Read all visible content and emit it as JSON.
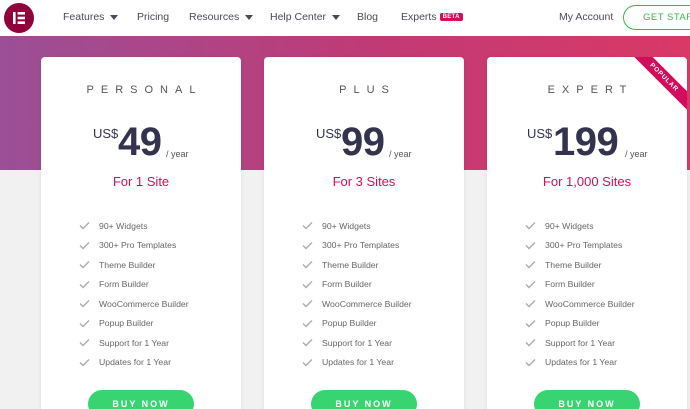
{
  "nav": {
    "logo_icon": "elementor-logo-icon",
    "items": [
      {
        "label": "Features",
        "dropdown": true
      },
      {
        "label": "Pricing",
        "dropdown": false
      },
      {
        "label": "Resources",
        "dropdown": true
      },
      {
        "label": "Help Center",
        "dropdown": true
      },
      {
        "label": "Blog",
        "dropdown": false
      },
      {
        "label": "Experts",
        "dropdown": false,
        "badge": "BETA"
      }
    ],
    "account_label": "My Account",
    "cta_label": "GET STARTED"
  },
  "colors": {
    "accent": "#d30c5c",
    "button_green": "#39d472",
    "cta_green": "#39b54a",
    "band_start": "#9b4f96",
    "band_end": "#d93966"
  },
  "plans": [
    {
      "name": "PERSONAL",
      "currency": "US$",
      "price": "49",
      "period": "/ year",
      "sites": "For 1 Site",
      "features": [
        "90+ Widgets",
        "300+ Pro Templates",
        "Theme Builder",
        "Form Builder",
        "WooCommerce Builder",
        "Popup Builder",
        "Support for 1 Year",
        "Updates for 1 Year"
      ],
      "button": "BUY NOW"
    },
    {
      "name": "PLUS",
      "currency": "US$",
      "price": "99",
      "period": "/ year",
      "sites": "For 3 Sites",
      "features": [
        "90+ Widgets",
        "300+ Pro Templates",
        "Theme Builder",
        "Form Builder",
        "WooCommerce Builder",
        "Popup Builder",
        "Support for 1 Year",
        "Updates for 1 Year"
      ],
      "button": "BUY NOW"
    },
    {
      "name": "EXPERT",
      "currency": "US$",
      "price": "199",
      "period": "/ year",
      "sites": "For 1,000 Sites",
      "ribbon": "POPULAR",
      "features": [
        "90+ Widgets",
        "300+ Pro Templates",
        "Theme Builder",
        "Form Builder",
        "WooCommerce Builder",
        "Popup Builder",
        "Support for 1 Year",
        "Updates for 1 Year"
      ],
      "button": "BUY NOW"
    }
  ]
}
